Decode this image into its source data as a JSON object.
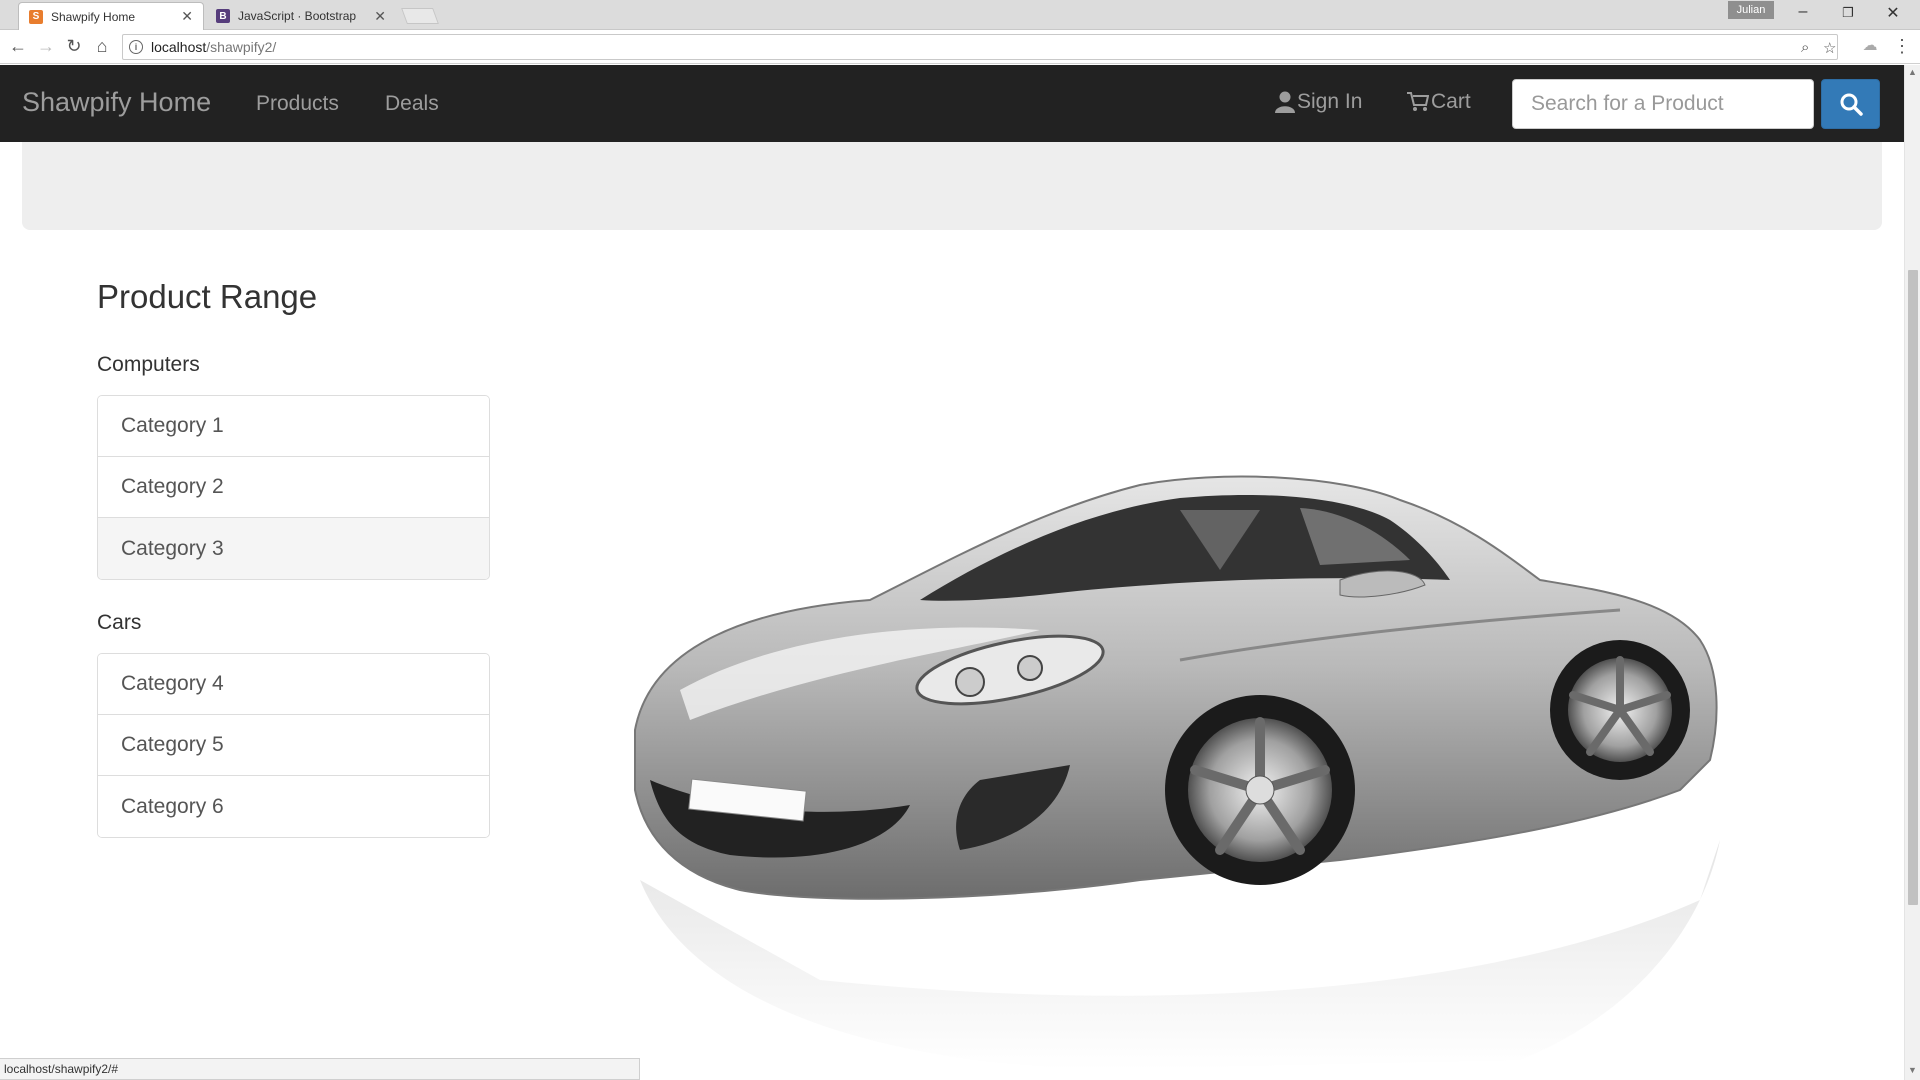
{
  "browser": {
    "tabs": [
      {
        "title": "Shawpify Home",
        "favicon": "S",
        "favicon_color": "#e87d2e",
        "active": true
      },
      {
        "title": "JavaScript · Bootstrap",
        "favicon": "B",
        "favicon_color": "#563d7c",
        "active": false
      }
    ],
    "profile_name": "Julian",
    "url_host": "localhost",
    "url_path": "/shawpify2/",
    "status_text": "localhost/shawpify2/#"
  },
  "navbar": {
    "brand": "Shawpify Home",
    "links": [
      "Products",
      "Deals"
    ],
    "sign_in": "Sign In",
    "cart": "Cart",
    "search_placeholder": "Search for a Product"
  },
  "content": {
    "title": "Product Range",
    "groups": [
      {
        "name": "Computers",
        "items": [
          "Category 1",
          "Category 2",
          "Category 3"
        ]
      },
      {
        "name": "Cars",
        "items": [
          "Category 4",
          "Category 5",
          "Category 6"
        ]
      }
    ]
  },
  "colors": {
    "navbar_bg": "#222222",
    "nav_text": "#9d9d9d",
    "search_button": "#337ab7",
    "jumbotron": "#eeeeee"
  }
}
